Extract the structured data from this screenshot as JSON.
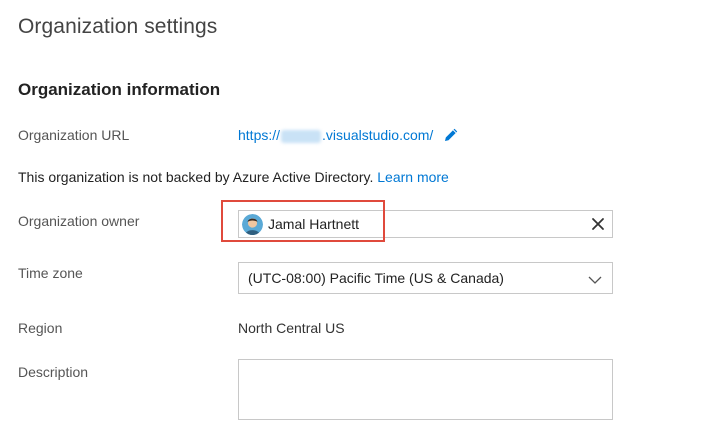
{
  "page": {
    "title": "Organization settings"
  },
  "section": {
    "title": "Organization information"
  },
  "org_url": {
    "label": "Organization URL",
    "prefix": "https://",
    "suffix": ".visualstudio.com/",
    "edit_icon": "pencil-icon"
  },
  "aad": {
    "message": "This organization is not backed by Azure Active Directory.",
    "link": "Learn more"
  },
  "owner": {
    "label": "Organization owner",
    "name": "Jamal Hartnett",
    "clear_icon": "close-icon"
  },
  "timezone": {
    "label": "Time zone",
    "value": "(UTC-08:00) Pacific Time (US & Canada)",
    "chevron_icon": "chevron-down-icon"
  },
  "region": {
    "label": "Region",
    "value": "North Central US"
  },
  "description": {
    "label": "Description",
    "value": ""
  },
  "colors": {
    "link": "#0078d4",
    "highlight": "#e04a3c",
    "border": "#c8c8c8"
  }
}
